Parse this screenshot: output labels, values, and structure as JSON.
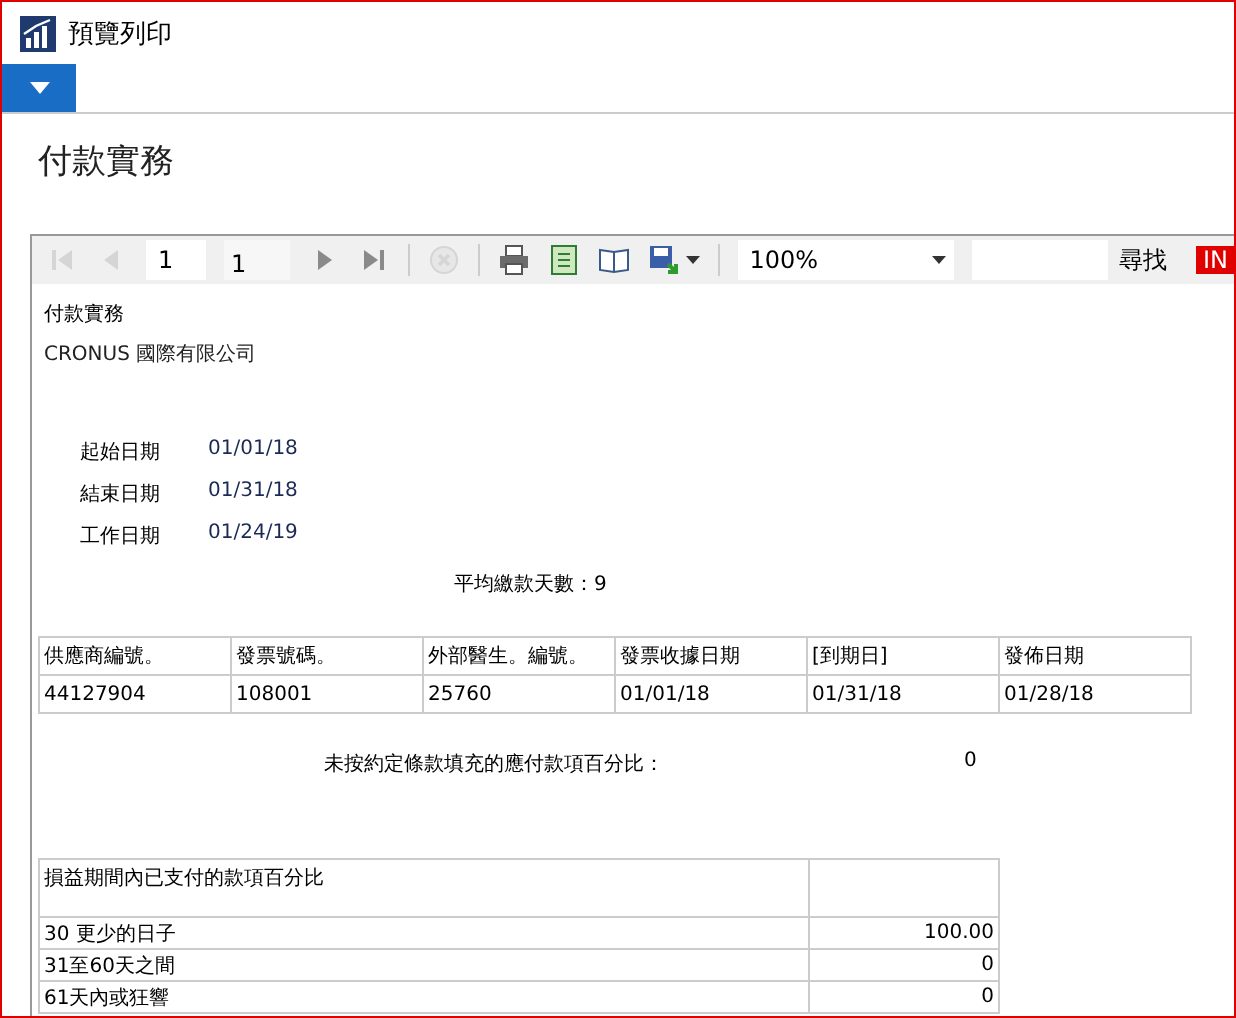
{
  "window": {
    "title": "預覽列印"
  },
  "page_title": "付款實務",
  "toolbar": {
    "nav": [
      {
        "kind": "first",
        "disabled": true
      },
      {
        "kind": "prev",
        "disabled": true
      }
    ],
    "page": "1",
    "page_count": "1",
    "nav_after": [
      {
        "kind": "next",
        "disabled": false
      },
      {
        "kind": "last",
        "disabled": false
      }
    ],
    "tools": [
      {
        "kind": "stop",
        "disabled": true
      },
      {
        "kind": "print",
        "disabled": false
      },
      {
        "kind": "setup",
        "disabled": false
      },
      {
        "kind": "layout",
        "disabled": false
      },
      {
        "kind": "export",
        "disabled": false
      }
    ],
    "zoom": "100%",
    "find_label": "尋找",
    "find_next": "IN"
  },
  "report": {
    "title": "付款實務",
    "company": "CRONUS 國際有限公司",
    "dates": [
      {
        "label": "起始日期",
        "value": "01/01/18"
      },
      {
        "label": "結束日期",
        "value": "01/31/18"
      },
      {
        "label": "工作日期",
        "value": "01/24/19"
      }
    ],
    "average": "平均繳款天數：9",
    "table": {
      "columns": [
        "供應商編號。",
        "發票號碼。",
        "外部醫生。編號。",
        "發票收據日期",
        "[到期日]",
        "發佈日期"
      ],
      "rows": [
        [
          "44127904",
          "108001",
          "25760",
          "01/01/18",
          "01/31/18",
          "01/28/18"
        ]
      ]
    },
    "overdue_label": "未按約定條款填充的應付款項百分比：",
    "overdue_value": "0",
    "paid": {
      "heading": "損益期間內已支付的款項百分比",
      "rows": [
        {
          "label": "30 更少的日子",
          "value": "100.00"
        },
        {
          "label": "31至60天之間",
          "value": "0"
        },
        {
          "label": "61天內或狂響",
          "value": "0"
        }
      ]
    }
  }
}
